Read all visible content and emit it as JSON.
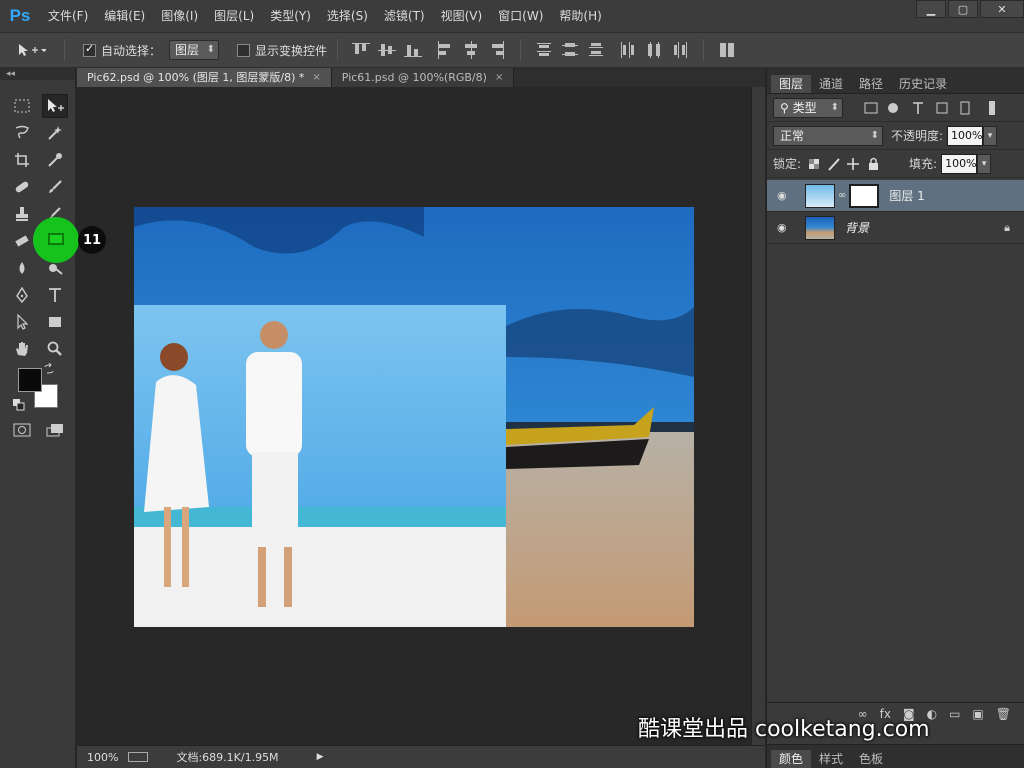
{
  "app": {
    "logo": "Ps"
  },
  "menu": [
    "文件(F)",
    "编辑(E)",
    "图像(I)",
    "图层(L)",
    "类型(Y)",
    "选择(S)",
    "滤镜(T)",
    "视图(V)",
    "窗口(W)",
    "帮助(H)"
  ],
  "window_controls": {
    "minimize": "▁",
    "restore": "▢",
    "close": "✕"
  },
  "options": {
    "auto_select_label": "自动选择：",
    "auto_select_value": "图层",
    "show_transform_label": "显示变换控件"
  },
  "toolbox": {
    "collapse": "◂◂"
  },
  "tabs": [
    {
      "label": "Pic62.psd @ 100% (图层 1, 图层蒙版/8) *",
      "close": "×"
    },
    {
      "label": "Pic61.psd @ 100%(RGB/8)",
      "close": "×"
    }
  ],
  "status": {
    "zoom": "100%",
    "doc_info": "文档:689.1K/1.95M",
    "arrow": "▶"
  },
  "panels": {
    "tabs": [
      "图层",
      "通道",
      "路径",
      "历史记录"
    ],
    "filter_kind": "类型",
    "blend_mode": "正常",
    "opacity_label": "不透明度:",
    "opacity_value": "100%",
    "lock_label": "锁定:",
    "fill_label": "填充:",
    "fill_value": "100%",
    "layers": [
      {
        "name": "图层 1",
        "selected": true
      },
      {
        "name": "背景",
        "locked": true
      }
    ],
    "bottom_tabs": [
      "颜色",
      "样式",
      "色板"
    ]
  },
  "step_badge": "11",
  "watermark": "酷课堂出品 coolketang.com",
  "colors": {
    "accent": "#31a8ff",
    "badge": "#16c21c",
    "selected_layer": "#5f7180"
  }
}
